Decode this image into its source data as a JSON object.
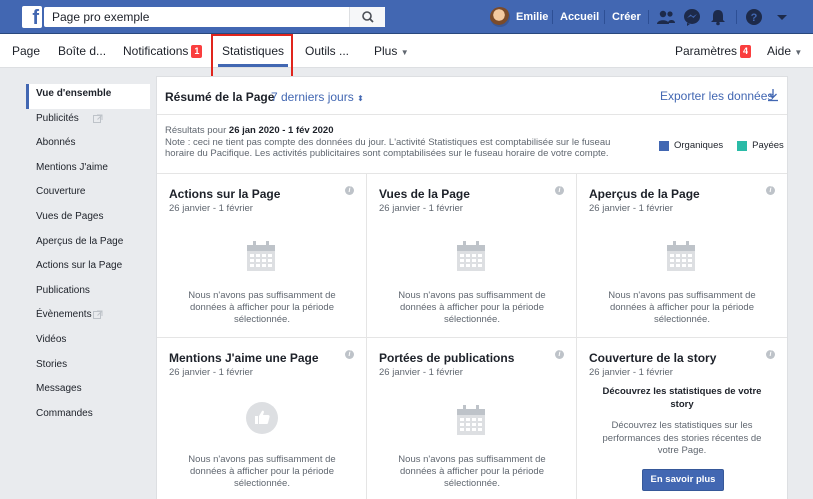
{
  "topbar": {
    "logo": "f",
    "search_value": "Page pro exemple",
    "user_name": "Emilie",
    "home": "Accueil",
    "create": "Créer",
    "icons": [
      "friends-icon",
      "messenger-icon",
      "notifications-icon",
      "help-icon",
      "caret-down-icon"
    ]
  },
  "subnav": {
    "page": "Page",
    "inbox": "Boîte d...",
    "notifications": "Notifications",
    "notifications_badge": "1",
    "insights": "Statistiques",
    "tools": "Outils ...",
    "more": "Plus",
    "settings": "Paramètres",
    "settings_badge": "4",
    "help": "Aide"
  },
  "sidebar": {
    "items": [
      "Vue d'ensemble",
      "Publicités",
      "Abonnés",
      "Mentions J'aime",
      "Couverture",
      "Vues de Pages",
      "Aperçus de la Page",
      "Actions sur la Page",
      "Publications",
      "Évènements",
      "Vidéos",
      "Stories",
      "Messages",
      "Commandes"
    ]
  },
  "summary": {
    "title": "Résumé de la Page",
    "range": "7 derniers jours",
    "export": "Exporter les données",
    "results_prefix": "Résultats pour ",
    "results_dates": "26 jan 2020 - 1 fév 2020",
    "note": "Note : ceci ne tient pas compte des données du jour. L'activité Statistiques est comptabilisée sur le fuseau horaire du Pacifique. Les activités publicitaires sont comptabilisées sur le fuseau horaire de votre compte.",
    "legend": [
      {
        "label": "Organiques",
        "color": "#4267b2"
      },
      {
        "label": "Payées",
        "color": "#2abba7"
      }
    ]
  },
  "cards": [
    {
      "title": "Actions sur la Page",
      "date": "26 janvier - 1 février",
      "message": "Nous n'avons pas suffisamment de données à afficher pour la période sélectionnée."
    },
    {
      "title": "Vues de la Page",
      "date": "26 janvier - 1 février",
      "message": "Nous n'avons pas suffisamment de données à afficher pour la période sélectionnée."
    },
    {
      "title": "Aperçus de la Page",
      "date": "26 janvier - 1 février",
      "message": "Nous n'avons pas suffisamment de données à afficher pour la période sélectionnée."
    },
    {
      "title": "Mentions J'aime une Page",
      "date": "26 janvier - 1 février",
      "message": "Nous n'avons pas suffisamment de données à afficher pour la période sélectionnée."
    },
    {
      "title": "Portées de publications",
      "date": "26 janvier - 1 février",
      "message": "Nous n'avons pas suffisamment de données à afficher pour la période sélectionnée."
    },
    {
      "title": "Couverture de la story",
      "date": "26 janvier - 1 février",
      "headline": "Découvrez les statistiques de votre story",
      "description": "Découvrez les statistiques sur les performances des stories récentes de votre Page.",
      "button": "En savoir plus"
    }
  ],
  "colors": {
    "brand_blue": "#4267b2",
    "highlight_red": "#e0251d",
    "badge_red": "#fa3e3e"
  }
}
